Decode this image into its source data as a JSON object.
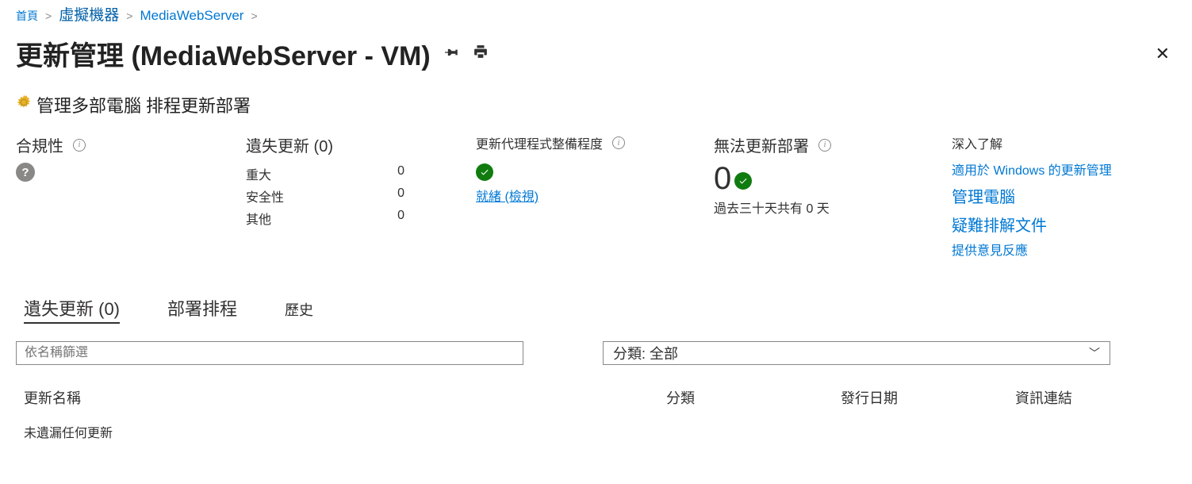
{
  "breadcrumb": {
    "home": "首頁",
    "vms": "虛擬機器",
    "server": "MediaWebServer"
  },
  "title": "更新管理 (MediaWebServer -   VM)",
  "toolbar": {
    "manage": "管理多部電腦",
    "schedule": "排程更新部署"
  },
  "stats": {
    "compliance_label": "合規性",
    "missing_label": "遺失更新 (0)",
    "missing": {
      "critical_label": "重大",
      "critical_val": "0",
      "security_label": "安全性",
      "security_val": "0",
      "other_label": "其他",
      "other_val": "0"
    },
    "agent_label": "更新代理程式整備程度",
    "agent_ready": "就緒 (檢視)",
    "deploy_label": "無法更新部署",
    "deploy_val": "0",
    "deploy_past": "過去三十天共有 0 天",
    "learn_label": "深入了解",
    "links": {
      "a": "適用於 Windows 的更新管理",
      "b": "管理電腦",
      "c": "疑難排解文件",
      "d": "提供意見反應"
    }
  },
  "tabs": {
    "missing": "遺失更新 (0)",
    "schedule": "部署排程",
    "history": "歷史"
  },
  "filter": {
    "placeholder": "依名稱篩選",
    "category_label": "分類: 全部"
  },
  "table": {
    "col_name": "更新名稱",
    "col_cat": "分類",
    "col_date": "發行日期",
    "col_link": "資訊連結",
    "empty": "未遺漏任何更新"
  }
}
